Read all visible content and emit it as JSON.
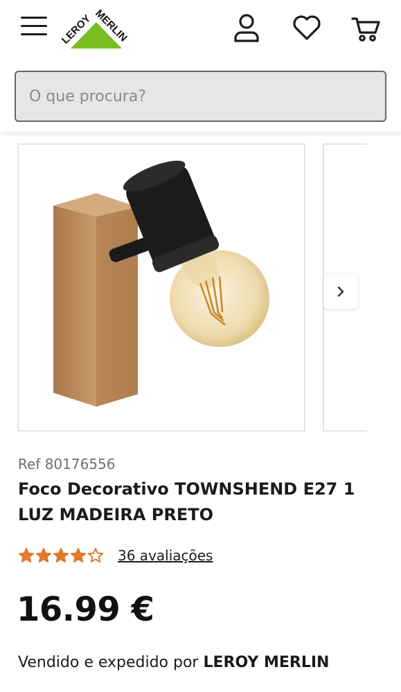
{
  "header": {
    "logo_text_top": "LEROY",
    "logo_text_bottom": "MERLIN",
    "brand_color": "#78BE20",
    "icons": [
      "menu-icon",
      "user-icon",
      "heart-icon",
      "cart-icon"
    ]
  },
  "search": {
    "placeholder": "O que procura?"
  },
  "product": {
    "ref": "Ref 80176556",
    "title": "Foco Decorativo TOWNSHEND E27 1 LUZ MADEIRA PRETO",
    "rating": 4.5,
    "rating_max": 5,
    "reviews_label": "36 avaliações",
    "star_color": "#E07A2E",
    "price": "16.99 €",
    "seller_prefix": "Vendido e expedido por ",
    "seller_name": "LEROY MERLIN"
  },
  "carousel": {
    "next_icon": "chevron-right-icon"
  }
}
